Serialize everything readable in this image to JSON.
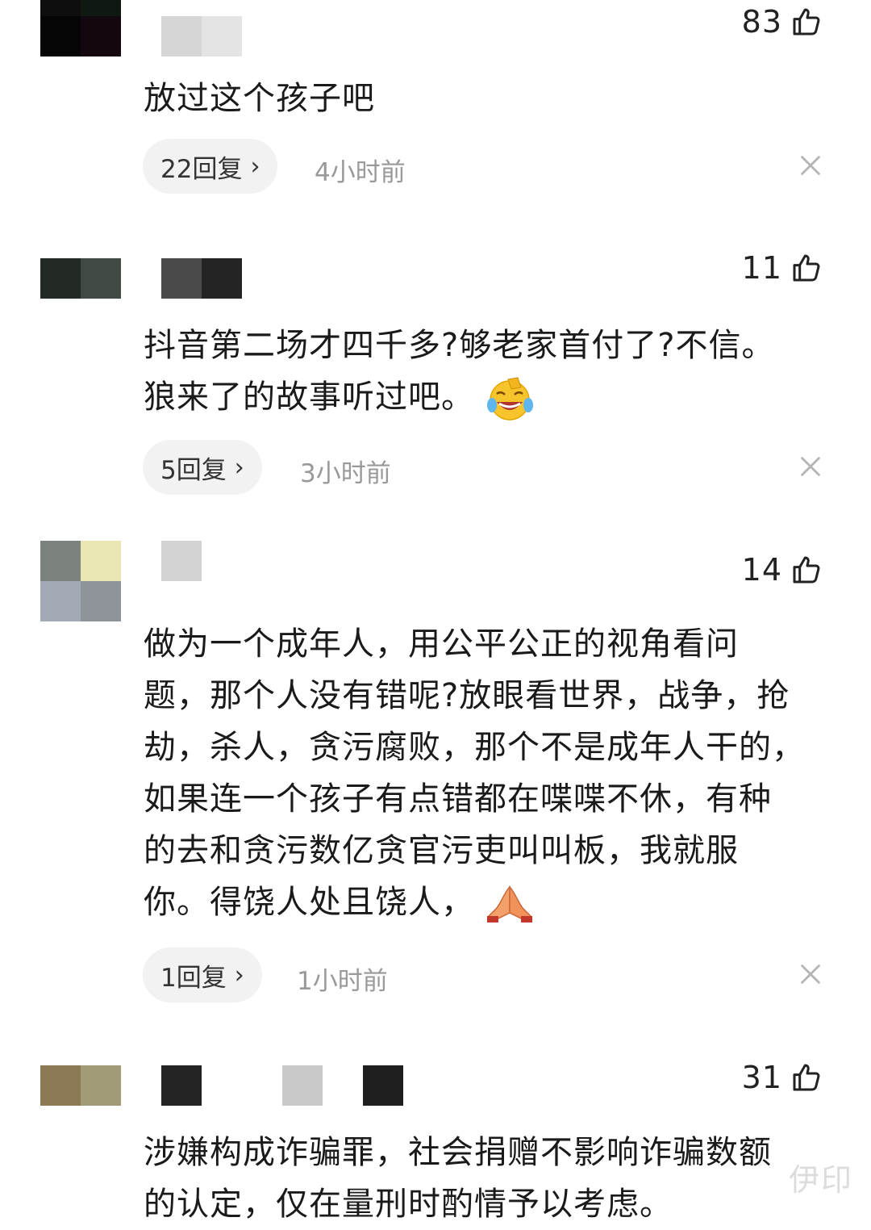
{
  "comments": [
    {
      "likes": "83",
      "text_lines": [
        "放过这个孩子吧"
      ],
      "reply_label": "22回复",
      "time": "4小时前"
    },
    {
      "likes": "11",
      "text_lines": [
        "抖音第二场才四千多?够老家首付了?不信。",
        "狼来了的故事听过吧。"
      ],
      "emoji": "laughing-crying-emoji",
      "reply_label": "5回复",
      "time": "3小时前"
    },
    {
      "likes": "14",
      "text_lines": [
        "做为一个成年人，用公平公正的视角看问",
        "题，那个人没有错呢?放眼看世界，战争，抢",
        "劫，杀人，贪污腐败，那个不是成年人干的，",
        "如果连一个孩子有点错都在喋喋不休，有种",
        "的去和贪污数亿贪官污吏叫叫板，我就服",
        "你。得饶人处且饶人，"
      ],
      "emoji": "praying-hands-emoji",
      "reply_label": "1回复",
      "time": "1小时前"
    },
    {
      "likes": "31",
      "text_lines": [
        "涉嫌构成诈骗罪，社会捐赠不影响诈骗数额",
        "的认定，仅在量刑时酌情予以考虑。"
      ]
    }
  ],
  "watermark": "伊印",
  "colors": {
    "pill_bg": "#f2f2f2",
    "muted_text": "#999999",
    "body_text": "#1a1a1a"
  }
}
